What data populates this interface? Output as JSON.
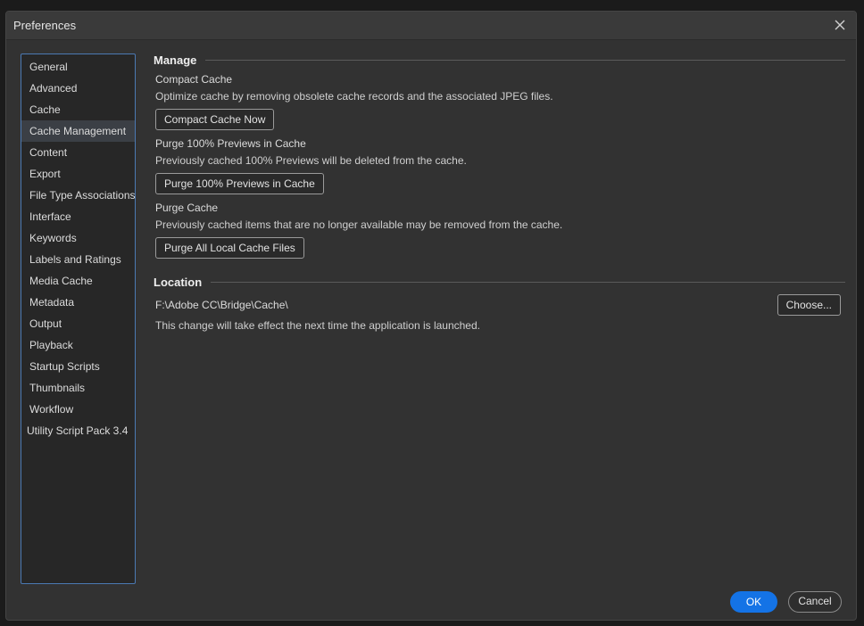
{
  "window": {
    "title": "Preferences",
    "close_icon": "close-icon"
  },
  "sidebar": {
    "selected_index": 3,
    "items": [
      {
        "label": "General"
      },
      {
        "label": "Advanced"
      },
      {
        "label": "Cache"
      },
      {
        "label": "Cache Management"
      },
      {
        "label": "Content"
      },
      {
        "label": "Export"
      },
      {
        "label": "File Type Associations"
      },
      {
        "label": "Interface"
      },
      {
        "label": "Keywords"
      },
      {
        "label": "Labels and Ratings"
      },
      {
        "label": "Media Cache"
      },
      {
        "label": "Metadata"
      },
      {
        "label": "Output"
      },
      {
        "label": "Playback"
      },
      {
        "label": "Startup Scripts"
      },
      {
        "label": "Thumbnails"
      },
      {
        "label": "Workflow"
      },
      {
        "label": "Utility Script Pack 3.4"
      }
    ]
  },
  "manage": {
    "title": "Manage",
    "compact": {
      "title": "Compact Cache",
      "description": "Optimize cache by removing obsolete cache records and the associated JPEG files.",
      "button_label": "Compact Cache Now"
    },
    "purge_previews": {
      "title": "Purge 100% Previews in Cache",
      "description": "Previously cached 100% Previews will be deleted from the cache.",
      "button_label": "Purge 100% Previews in Cache"
    },
    "purge_cache": {
      "title": "Purge Cache",
      "description": "Previously cached items that are no longer available may be removed from the cache.",
      "button_label": "Purge All Local Cache Files"
    }
  },
  "location": {
    "title": "Location",
    "path": "F:\\Adobe CC\\Bridge\\Cache\\",
    "choose_label": "Choose...",
    "note": "This change will take effect the next time the application is launched."
  },
  "footer": {
    "ok_label": "OK",
    "cancel_label": "Cancel"
  },
  "colors": {
    "accent": "#1473e6",
    "sidebar_border": "#4b79b3",
    "dialog_bg": "#323232"
  }
}
